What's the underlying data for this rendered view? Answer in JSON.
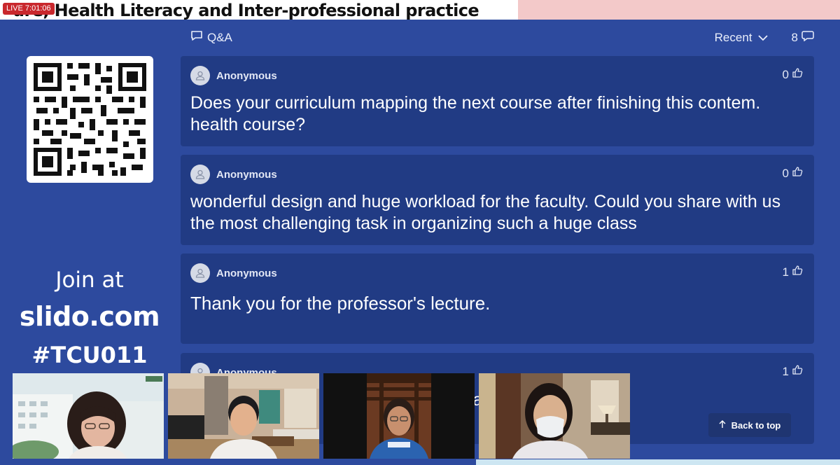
{
  "banner": {
    "live": "LIVE 7:01:06",
    "title": "ure, Health Literacy and Inter-professional practice"
  },
  "sidebar": {
    "join_at": "Join at",
    "site": "slido.com",
    "code": "#TCU011"
  },
  "qa": {
    "title": "Q&A",
    "sort": "Recent",
    "count": "8"
  },
  "questions": [
    {
      "author": "Anonymous",
      "likes": "0",
      "text": "Does your curriculum mapping the next course after finishing this contem. health course?"
    },
    {
      "author": "Anonymous",
      "likes": "0",
      "text": "wonderful design and huge workload for the faculty. Could you share with us the most challenging task in organizing such a huge class"
    },
    {
      "author": "Anonymous",
      "likes": "1",
      "text": "Thank you for the professor's lecture."
    },
    {
      "author": "Anonymous",
      "likes": "1",
      "text": "l a he speaker's"
    }
  ],
  "back_to_top": "Back to top",
  "colors": {
    "background": "#2d4a9e",
    "card": "#213b84",
    "live": "#c9282d",
    "banner": "#ffffff",
    "banner_pink": "#f3c9c9"
  },
  "icons": [
    "chat-bubble-icon",
    "chevron-down-icon",
    "comment-count-icon",
    "user-avatar-icon",
    "thumbs-up-icon",
    "arrow-up-icon",
    "qr-code"
  ]
}
